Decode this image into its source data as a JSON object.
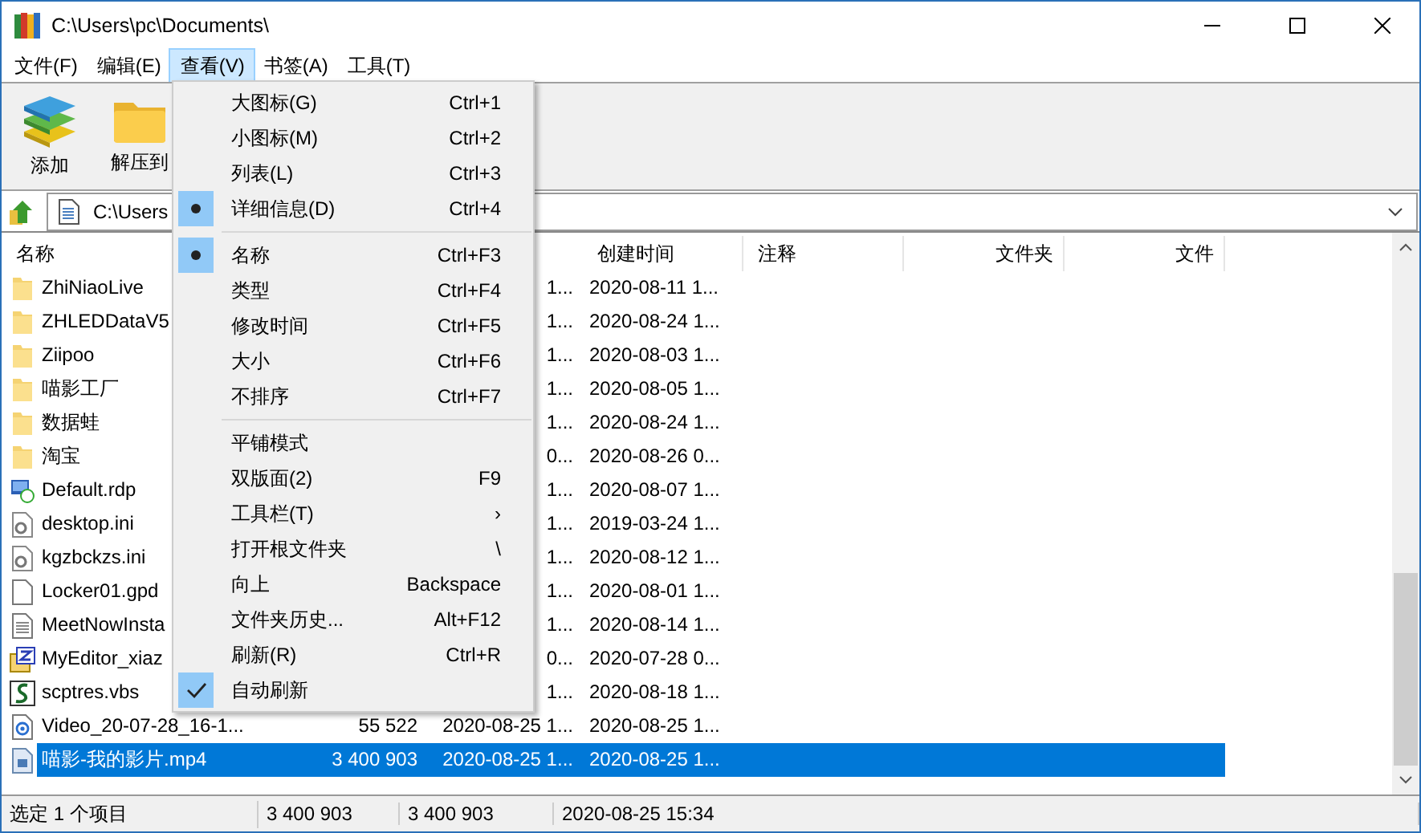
{
  "window": {
    "title": "C:\\Users\\pc\\Documents\\"
  },
  "menu_bar": [
    {
      "label": "文件(F)",
      "selected": false
    },
    {
      "label": "编辑(E)",
      "selected": false
    },
    {
      "label": "查看(V)",
      "selected": true
    },
    {
      "label": "书签(A)",
      "selected": false
    },
    {
      "label": "工具(T)",
      "selected": false
    }
  ],
  "toolbar": [
    {
      "label": "添加",
      "kind": "books"
    },
    {
      "label": "解压到",
      "kind": "folder"
    }
  ],
  "address_bar": {
    "value": "C:\\Users"
  },
  "table": {
    "columns": [
      "名称",
      "创建时间",
      "注释",
      "文件夹",
      "文件"
    ],
    "rows": [
      {
        "name": "ZhiNiaoLive",
        "modified": "1...",
        "created": "2020-08-11 1...",
        "kind": "folder",
        "selected": false
      },
      {
        "name": "ZHLEDDataV5",
        "modified": "1...",
        "created": "2020-08-24 1...",
        "kind": "folder",
        "selected": false
      },
      {
        "name": "Ziipoo",
        "modified": "1...",
        "created": "2020-08-03 1...",
        "kind": "folder",
        "selected": false
      },
      {
        "name": "喵影工厂",
        "modified": "1...",
        "created": "2020-08-05 1...",
        "kind": "folder",
        "selected": false
      },
      {
        "name": "数据蛙",
        "modified": "1...",
        "created": "2020-08-24 1...",
        "kind": "folder",
        "selected": false
      },
      {
        "name": "淘宝",
        "modified": "0...",
        "created": "2020-08-26 0...",
        "kind": "folder",
        "selected": false
      },
      {
        "name": "Default.rdp",
        "modified": "1...",
        "created": "2020-08-07 1...",
        "kind": "remote",
        "selected": false
      },
      {
        "name": "desktop.ini",
        "modified": "1...",
        "created": "2019-03-24 1...",
        "kind": "settings",
        "selected": false
      },
      {
        "name": "kgzbckzs.ini",
        "modified": "1...",
        "created": "2020-08-12 1...",
        "kind": "settings",
        "selected": false
      },
      {
        "name": "Locker01.gpd",
        "modified": "1...",
        "created": "2020-08-01 1...",
        "kind": "blank",
        "selected": false
      },
      {
        "name": "MeetNowInsta",
        "modified": "1...",
        "created": "2020-08-14 1...",
        "kind": "text",
        "selected": false
      },
      {
        "name": "MyEditor_xiaz",
        "modified": "0...",
        "created": "2020-07-28 0...",
        "kind": "editor",
        "selected": false
      },
      {
        "name": "scptres.vbs",
        "modified": "1...",
        "created": "2020-08-18 1...",
        "kind": "script",
        "selected": false
      },
      {
        "name": "Video_20-07-28_16-1...",
        "size": "55 522",
        "modified": "2020-08-25 1...",
        "created": "2020-08-25 1...",
        "kind": "media",
        "selected": false
      },
      {
        "name": "喵影-我的影片.mp4",
        "size": "3 400 903",
        "modified": "2020-08-25 1...",
        "created": "2020-08-25 1...",
        "kind": "video",
        "selected": true
      }
    ]
  },
  "view_menu": [
    [
      {
        "label": "大图标(G)",
        "shortcut": "Ctrl+1",
        "checked": false
      },
      {
        "label": "小图标(M)",
        "shortcut": "Ctrl+2",
        "checked": false
      },
      {
        "label": "列表(L)",
        "shortcut": "Ctrl+3",
        "checked": false
      },
      {
        "label": "详细信息(D)",
        "shortcut": "Ctrl+4",
        "checked": true
      }
    ],
    [
      {
        "label": "名称",
        "shortcut": "Ctrl+F3",
        "checked": true
      },
      {
        "label": "类型",
        "shortcut": "Ctrl+F4",
        "checked": false
      },
      {
        "label": "修改时间",
        "shortcut": "Ctrl+F5",
        "checked": false
      },
      {
        "label": "大小",
        "shortcut": "Ctrl+F6",
        "checked": false
      },
      {
        "label": "不排序",
        "shortcut": "Ctrl+F7",
        "checked": false
      }
    ],
    [
      {
        "label": "平铺模式",
        "checked": false
      },
      {
        "label": "双版面(2)",
        "shortcut": "F9",
        "checked": false
      },
      {
        "label": "工具栏(T)",
        "shortcut": "›",
        "checked": false
      },
      {
        "label": "打开根文件夹",
        "shortcut": "\\",
        "checked": false
      },
      {
        "label": "向上",
        "shortcut": "Backspace",
        "checked": false
      },
      {
        "label": "文件夹历史...",
        "shortcut": "Alt+F12",
        "checked": false
      },
      {
        "label": "刷新(R)",
        "shortcut": "Ctrl+R",
        "checked": false
      },
      {
        "label": "自动刷新",
        "checked": true
      }
    ]
  ],
  "status_bar": [
    "选定 1 个项目",
    "3 400 903",
    "3 400 903",
    "2020-08-25 15:34"
  ]
}
